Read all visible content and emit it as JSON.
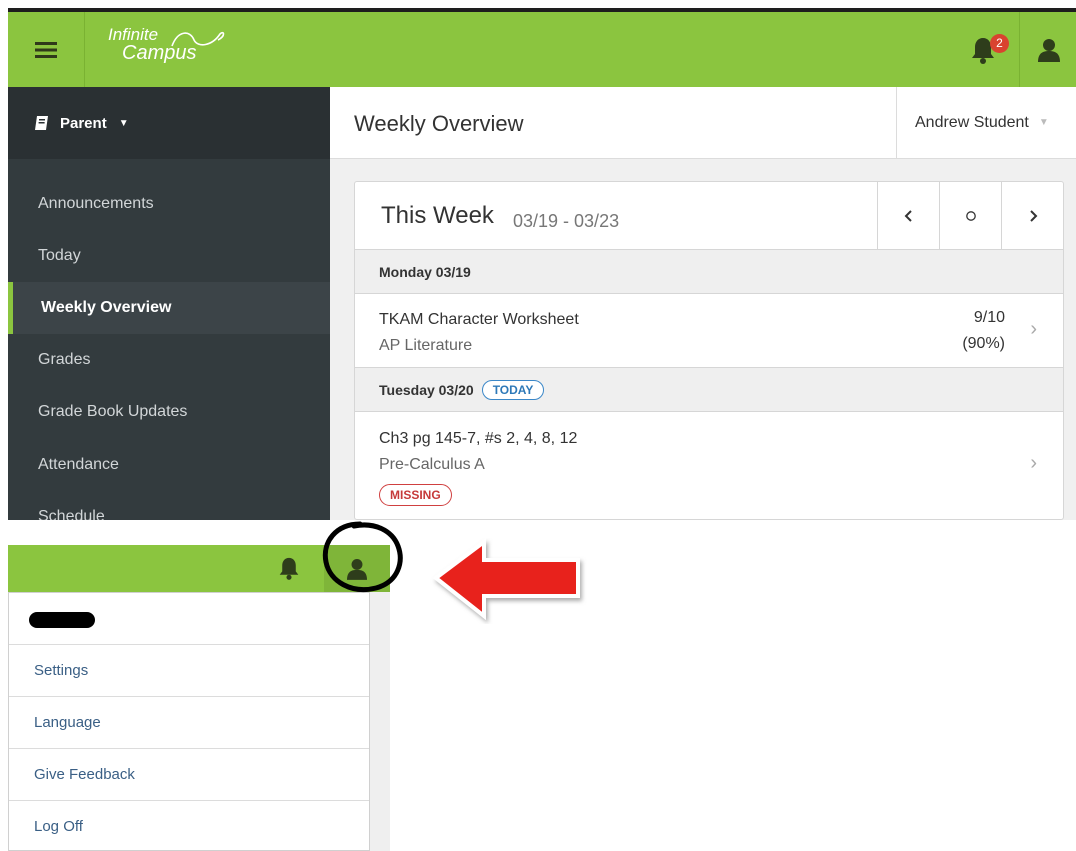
{
  "top_bar": {
    "logo_line1": "Infinite",
    "logo_line2": "Campus",
    "notification_count": "2",
    "brand_color": "#8bc53f"
  },
  "sidebar": {
    "role_label": "Parent",
    "items": [
      {
        "label": "Announcements"
      },
      {
        "label": "Today"
      },
      {
        "label": "Weekly Overview",
        "active": true
      },
      {
        "label": "Grades"
      },
      {
        "label": "Grade Book Updates"
      },
      {
        "label": "Attendance"
      },
      {
        "label": "Schedule"
      }
    ]
  },
  "header": {
    "title": "Weekly Overview",
    "student": "Andrew Student"
  },
  "week": {
    "title": "This Week",
    "range": "03/19 - 03/23",
    "prev_icon": "chevron-left-icon",
    "today_icon": "circle-icon",
    "next_icon": "chevron-right-icon",
    "days": [
      {
        "label": "Monday 03/19",
        "assignments": [
          {
            "title": "TKAM Character Worksheet",
            "course": "AP Literature",
            "score": "9/10",
            "percent": "(90%)"
          }
        ]
      },
      {
        "label": "Tuesday 03/20",
        "badge": "TODAY",
        "assignments": [
          {
            "title": "Ch3 pg 145-7, #s 2, 4, 8, 12",
            "course": "Pre-Calculus A",
            "flag": "MISSING"
          }
        ]
      }
    ]
  },
  "user_menu": {
    "items": [
      {
        "label": "Settings"
      },
      {
        "label": "Language"
      },
      {
        "label": "Give Feedback"
      },
      {
        "label": "Log Off"
      }
    ]
  },
  "annotation_color": "#e8201e"
}
